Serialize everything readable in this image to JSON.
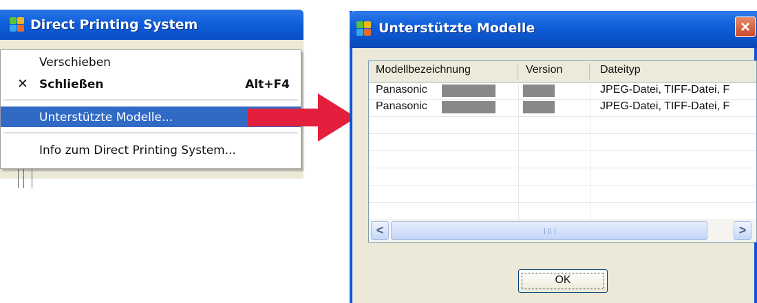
{
  "left_window": {
    "title": "Direct Printing System",
    "icon": "app-icon",
    "system_menu": {
      "items": [
        {
          "label": "Verschieben"
        },
        {
          "label": "Schließen",
          "shortcut": "Alt+F4",
          "icon": "close-x-icon"
        },
        {
          "label": "Unterstützte Modelle...",
          "selected": true
        },
        {
          "label": "Info zum Direct Printing System..."
        }
      ]
    }
  },
  "arrow": {
    "color": "#e2203d",
    "icon": "right-arrow-icon"
  },
  "dialog": {
    "title": "Unterstützte Modelle",
    "icon": "app-icon",
    "close_label": "×",
    "columns": [
      "Modellbezeichnung",
      "Version",
      "Dateityp"
    ],
    "rows": [
      {
        "model": "Panasonic",
        "filetypes": "JPEG-Datei, TIFF-Datei, F"
      },
      {
        "model": "Panasonic",
        "filetypes": "JPEG-Datei, TIFF-Datei, F"
      }
    ],
    "scroll_left": "<",
    "scroll_right": ">",
    "ok_label": "OK"
  },
  "colors": {
    "titlebar": "#0f5fdb",
    "menu_highlight": "#316ac5",
    "dialog_bg": "#ece9d8",
    "redaction": "#888888"
  }
}
